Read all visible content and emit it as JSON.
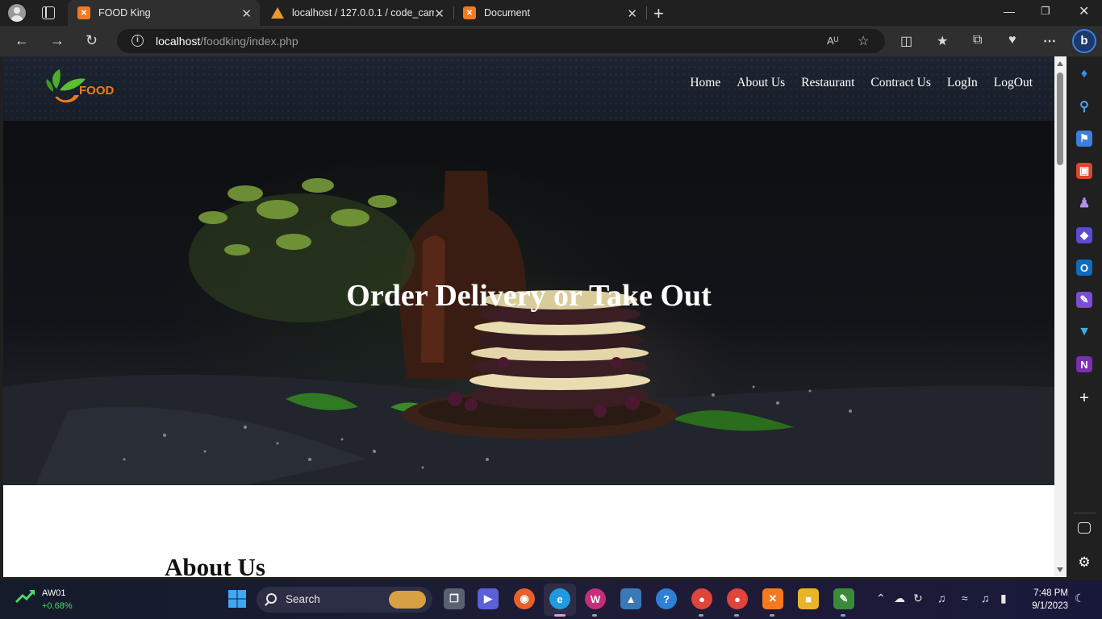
{
  "browser": {
    "tabs": [
      {
        "title": "FOOD King",
        "active": true
      },
      {
        "title": "localhost / 127.0.0.1 / code_camp",
        "active": false
      },
      {
        "title": "Document",
        "active": false
      }
    ],
    "url_host": "localhost",
    "url_path": "/foodking/index.php"
  },
  "site": {
    "logo_text": "FOOD",
    "nav": [
      "Home",
      "About Us",
      "Restaurant",
      "Contract Us",
      "LogIn",
      "LogOut"
    ],
    "hero_heading": "Order Delivery or Take Out",
    "section_heading": "About Us"
  },
  "taskbar": {
    "stock_ticker": "AW01",
    "stock_change": "+0.68%",
    "search_label": "Search",
    "time": "7:48 PM",
    "date": "9/1/2023"
  },
  "colors": {
    "header_bg": "#1b2430",
    "logo_green": "#4caf2a",
    "logo_orange": "#f07a1a",
    "xampp_orange": "#f57a1f"
  }
}
